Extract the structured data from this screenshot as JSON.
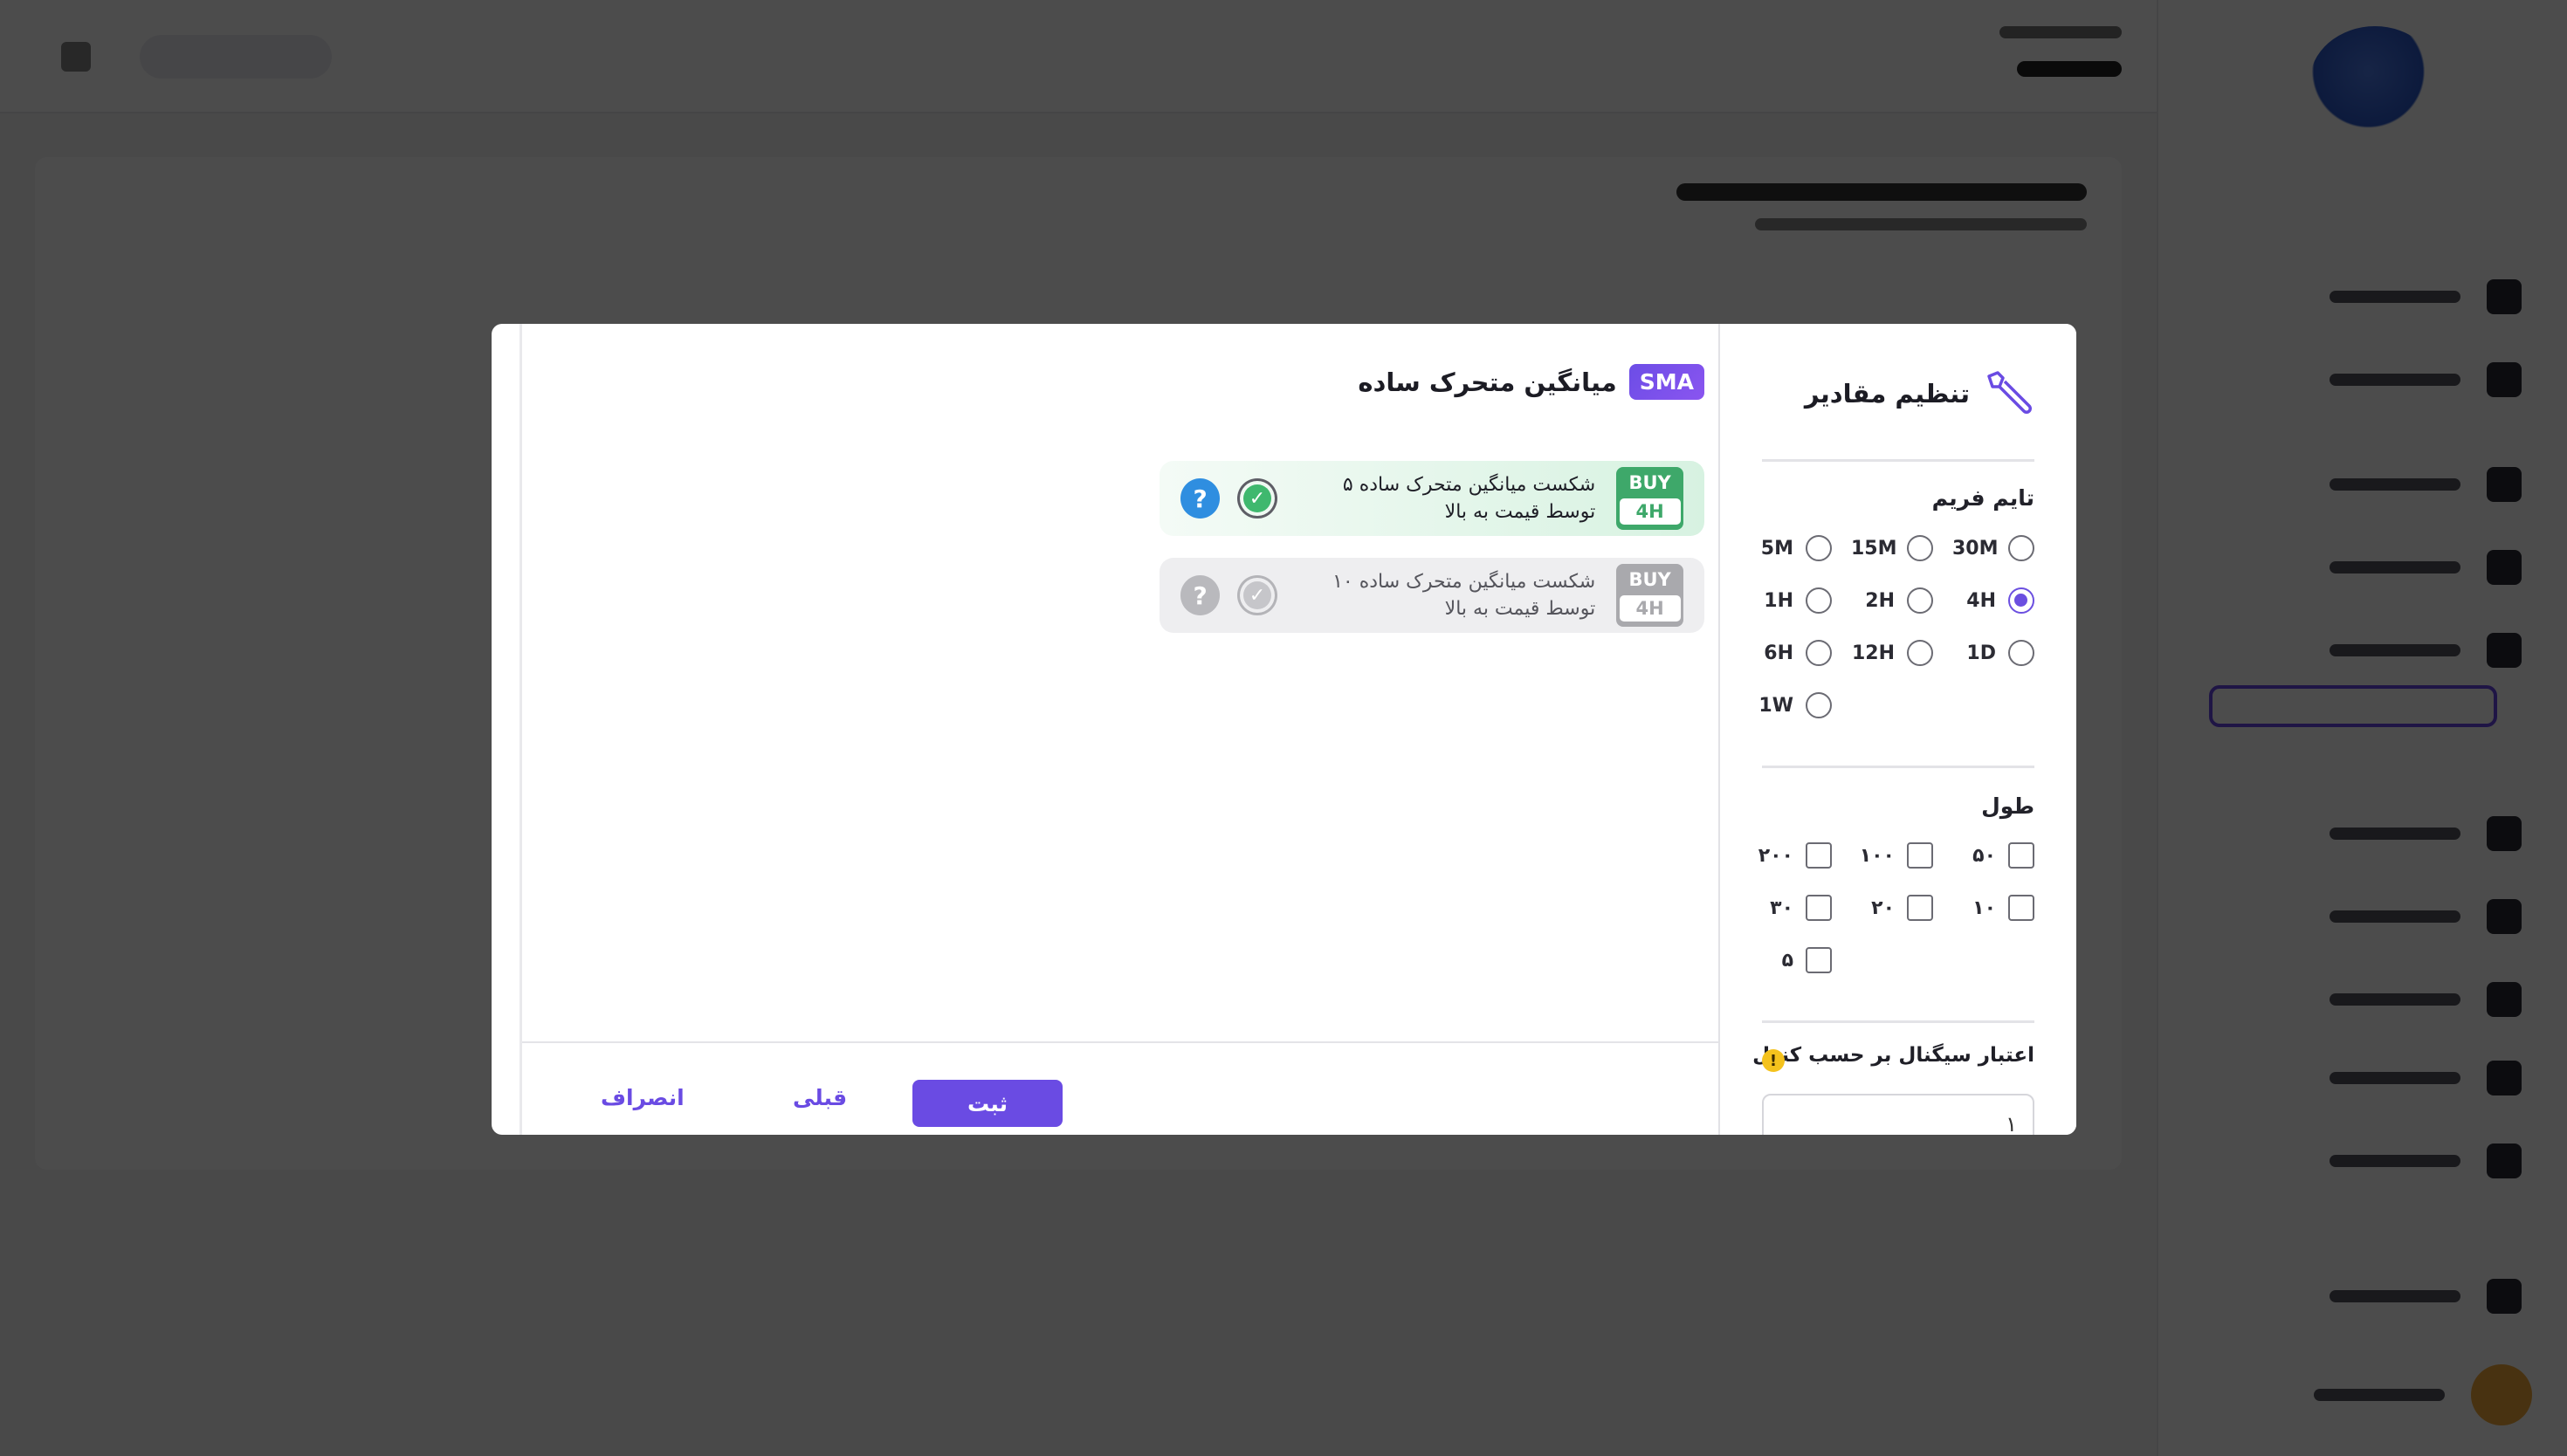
{
  "modal": {
    "settings": {
      "title": "تنظیم مقادیر",
      "timeframe": {
        "label": "تایم فریم",
        "options": [
          "30M",
          "15M",
          "5M",
          "4H",
          "2H",
          "1H",
          "1D",
          "12H",
          "6H",
          "1W"
        ],
        "selected": "4H"
      },
      "length": {
        "label": "طول",
        "options": [
          "۵۰",
          "۱۰۰",
          "۲۰۰",
          "۱۰",
          "۲۰",
          "۳۰",
          "۵"
        ]
      },
      "signal_validity": {
        "label": "اعتبار سیگنال بر حسب کندل",
        "warning_icon": "!",
        "value": "۱"
      }
    },
    "indicator": {
      "badge": "SMA",
      "name": "میانگین متحرک ساده"
    },
    "signals": [
      {
        "side": "BUY",
        "timeframe": "4H",
        "text": "شکست میانگین متحرک ساده ۵ توسط قیمت به بالا",
        "active": true,
        "check_icon": "✓",
        "help_icon": "?"
      },
      {
        "side": "BUY",
        "timeframe": "4H",
        "text": "شکست میانگین متحرک ساده ۱۰ توسط قیمت به بالا",
        "active": false,
        "check_icon": "✓",
        "help_icon": "?"
      }
    ],
    "footer": {
      "submit": "ثبت",
      "previous": "قبلی",
      "cancel": "انصراف"
    }
  },
  "colors": {
    "accent": "#6a4be3",
    "buy": "#3ea86a",
    "help": "#2f8ee0",
    "warning": "#f4c21d"
  }
}
